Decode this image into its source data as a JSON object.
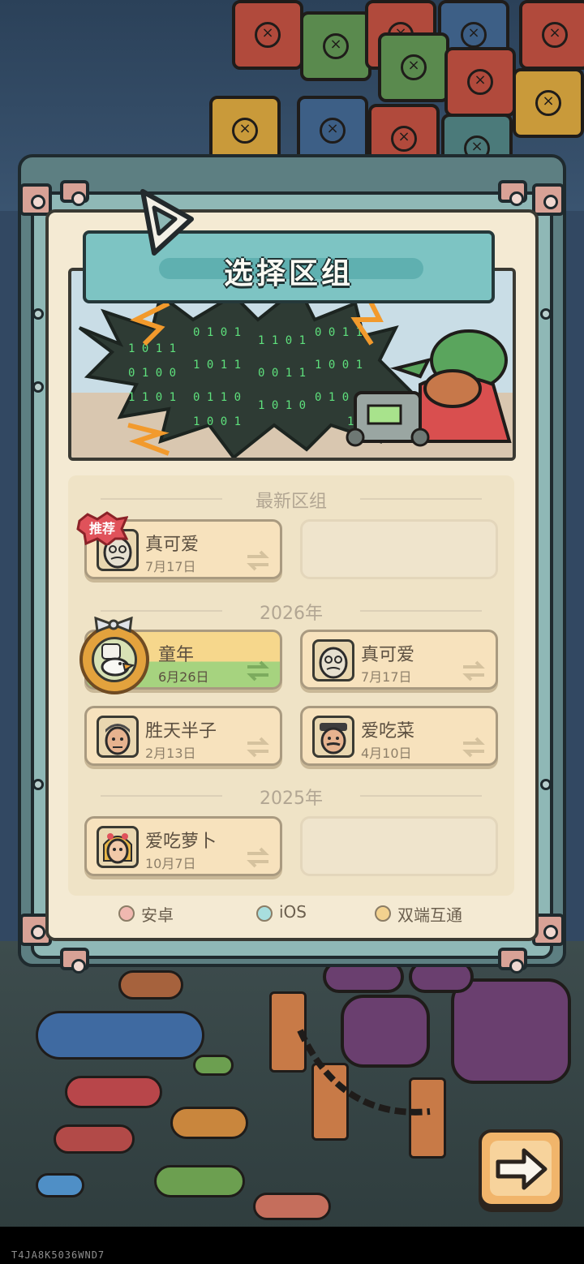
{
  "dialog": {
    "title": "选择区组",
    "back_icon": "back-arrow-icon"
  },
  "sections": [
    {
      "title": "最新区组"
    },
    {
      "title": "2026年"
    },
    {
      "title": "2025年"
    }
  ],
  "latest": {
    "tag": "推荐",
    "servers": [
      {
        "name": "真可爱",
        "date": "7月17日"
      }
    ]
  },
  "year_2026": {
    "servers": [
      {
        "name": "童年",
        "date": "6月26日",
        "selected": true
      },
      {
        "name": "真可爱",
        "date": "7月17日"
      },
      {
        "name": "胜天半子",
        "date": "2月13日"
      },
      {
        "name": "爱吃菜",
        "date": "4月10日"
      }
    ]
  },
  "year_2025": {
    "servers": [
      {
        "name": "爱吃萝卜",
        "date": "10月7日"
      }
    ]
  },
  "legend": [
    {
      "label": "安卓",
      "color": "#f0b8b0"
    },
    {
      "label": "iOS",
      "color": "#a8dede"
    },
    {
      "label": "双端互通",
      "color": "#f3d28f"
    }
  ],
  "next_button": {
    "icon": "arrow-right-icon"
  },
  "device_id": "T4JA8K5036WND7",
  "colors": {
    "banner": "#7dc4c3",
    "paper": "#f4ead3",
    "card": "#f7e2bd",
    "selected_top": "#f6d78c",
    "selected_bottom": "#a6d37f",
    "recommend_tag": "#e0525a"
  }
}
